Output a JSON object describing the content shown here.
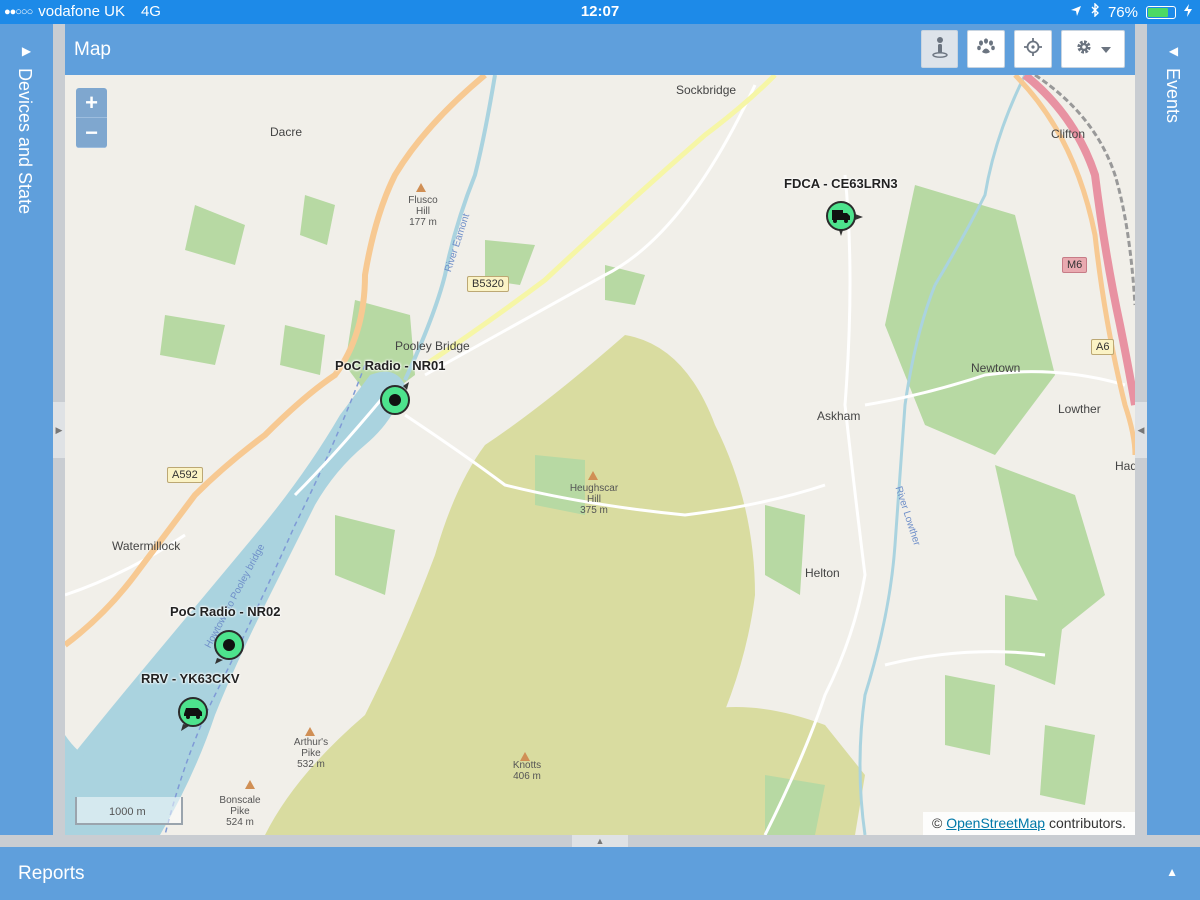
{
  "status": {
    "carrier": "vodafone UK",
    "network": "4G",
    "time": "12:07",
    "battery": "76%",
    "battery_level": 0.76,
    "signal_dots": "●●○○○"
  },
  "panels": {
    "left": "Devices and State",
    "right": "Events",
    "bottom": "Reports"
  },
  "map": {
    "title": "Map",
    "zoom_in": "+",
    "zoom_out": "−",
    "scale": "1000 m",
    "attribution_prefix": "©",
    "attribution_link": "OpenStreetMap",
    "attribution_suffix": "contributors.",
    "places": {
      "sockbridge": "Sockbridge",
      "dacre": "Dacre",
      "clifton": "Clifton",
      "flusco": "Flusco",
      "flusco2": "Hill",
      "flusco_h": "177 m",
      "pooley": "Pooley Bridge",
      "newtown": "Newtown",
      "lowther": "Lowther",
      "askham": "Askham",
      "heugh": "Heughscar",
      "heugh2": "Hill",
      "heugh_h": "375 m",
      "watermillock": "Watermillock",
      "helton": "Helton",
      "arthurs": "Arthur's",
      "arthurs2": "Pike",
      "arthurs_h": "532 m",
      "knotts": "Knotts",
      "knotts_h": "406 m",
      "bonscale": "Bonscale",
      "bonscale2": "Pike",
      "bonscale_h": "524 m",
      "had": "Had",
      "river_eamont": "River Eamont",
      "river_lowther": "River Lowther",
      "ferry": "Howtown to Pooley bridge"
    },
    "roads": {
      "b5320": "B5320",
      "a592": "A592",
      "m6": "M6",
      "a6": "A6"
    },
    "markers": [
      {
        "label": "PoC Radio - NR01",
        "type": "radio"
      },
      {
        "label": "PoC Radio - NR02",
        "type": "radio"
      },
      {
        "label": "RRV - YK63CKV",
        "type": "car"
      },
      {
        "label": "FDCA - CE63LRN3",
        "type": "truck"
      }
    ]
  },
  "colors": {
    "header_blue": "#5f9fdc",
    "status_blue": "#1d8ae8",
    "marker_green": "#4de38d",
    "water": "#aad3df"
  },
  "icons": [
    "location-arrow-icon",
    "bluetooth-icon",
    "person-pin-icon",
    "paw-icon",
    "crosshair-icon",
    "gear-icon",
    "caret-down-icon"
  ]
}
